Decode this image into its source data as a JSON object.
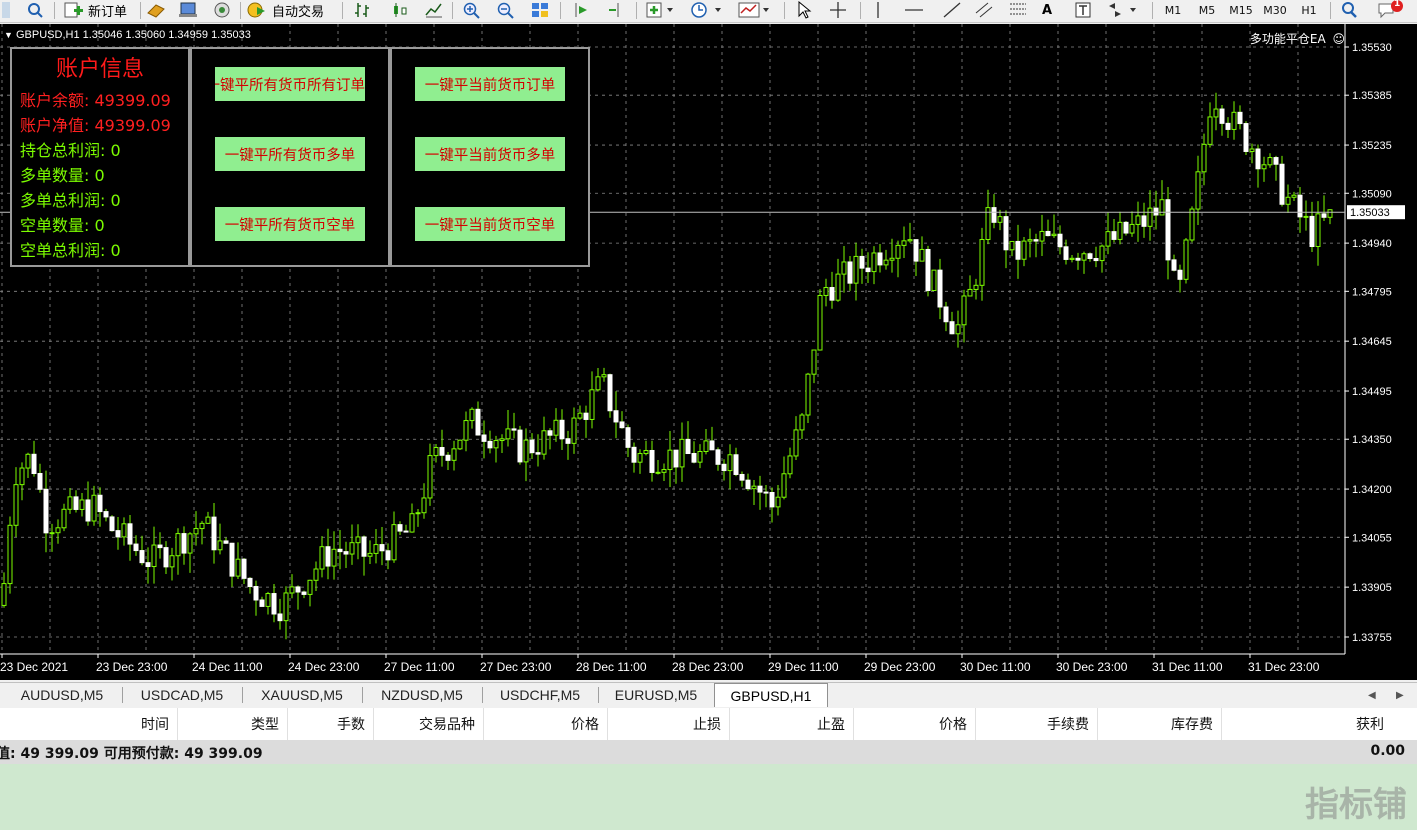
{
  "toolbar": {
    "new_order_label": "新订单",
    "auto_trade_label": "自动交易",
    "timeframes": [
      "M1",
      "M5",
      "M15",
      "M30",
      "H1"
    ],
    "notification_count": "1"
  },
  "chart": {
    "header": "GBPUSD,H1  1.35046 1.35060 1.34959 1.35033",
    "ea_name": "多功能平仓EA",
    "price_labels": [
      "1.35530",
      "1.35385",
      "1.35235",
      "1.35090",
      "1.34940",
      "1.34795",
      "1.34645",
      "1.34495",
      "1.34350",
      "1.34200",
      "1.34055",
      "1.33905",
      "1.33755"
    ],
    "current_price": "1.35033",
    "time_labels": [
      "23 Dec 2021",
      "23 Dec 23:00",
      "24 Dec 11:00",
      "24 Dec 23:00",
      "27 Dec 11:00",
      "27 Dec 23:00",
      "28 Dec 11:00",
      "28 Dec 23:00",
      "29 Dec 11:00",
      "29 Dec 23:00",
      "30 Dec 11:00",
      "30 Dec 23:00",
      "31 Dec 11:00",
      "31 Dec 23:00"
    ],
    "bull_color": "#7cfc00",
    "bear_color": "#ffffff"
  },
  "account": {
    "title": "账户信息",
    "balance": "账户余额: 49399.09",
    "equity": "账户净值: 49399.09",
    "total_profit": "持仓总利润: 0",
    "buy_count": "多单数量: 0",
    "buy_profit": "多单总利润: 0",
    "sell_count": "空单数量: 0",
    "sell_profit": "空单总利润: 0"
  },
  "buttons": {
    "close_all_all": "一键平所有货币所有订单",
    "close_all_buy": "一键平所有货币多单",
    "close_all_sell": "一键平所有货币空单",
    "close_cur_all": "一键平当前货币订单",
    "close_cur_buy": "一键平当前货币多单",
    "close_cur_sell": "一键平当前货币空单"
  },
  "tabs": [
    "AUDUSD,M5",
    "USDCAD,M5",
    "XAUUSD,M5",
    "NZDUSD,M5",
    "USDCHF,M5",
    "EURUSD,M5",
    "GBPUSD,H1"
  ],
  "active_tab": "GBPUSD,H1",
  "terminal": {
    "columns": [
      "时间",
      "类型",
      "手数",
      "交易品种",
      "价格",
      "止损",
      "止盈",
      "价格",
      "手续费",
      "库存费",
      "获利"
    ],
    "balance_text": "值: 49 399.09  可用预付款: 49 399.09",
    "profit": "0.00"
  },
  "watermark": "指标铺"
}
